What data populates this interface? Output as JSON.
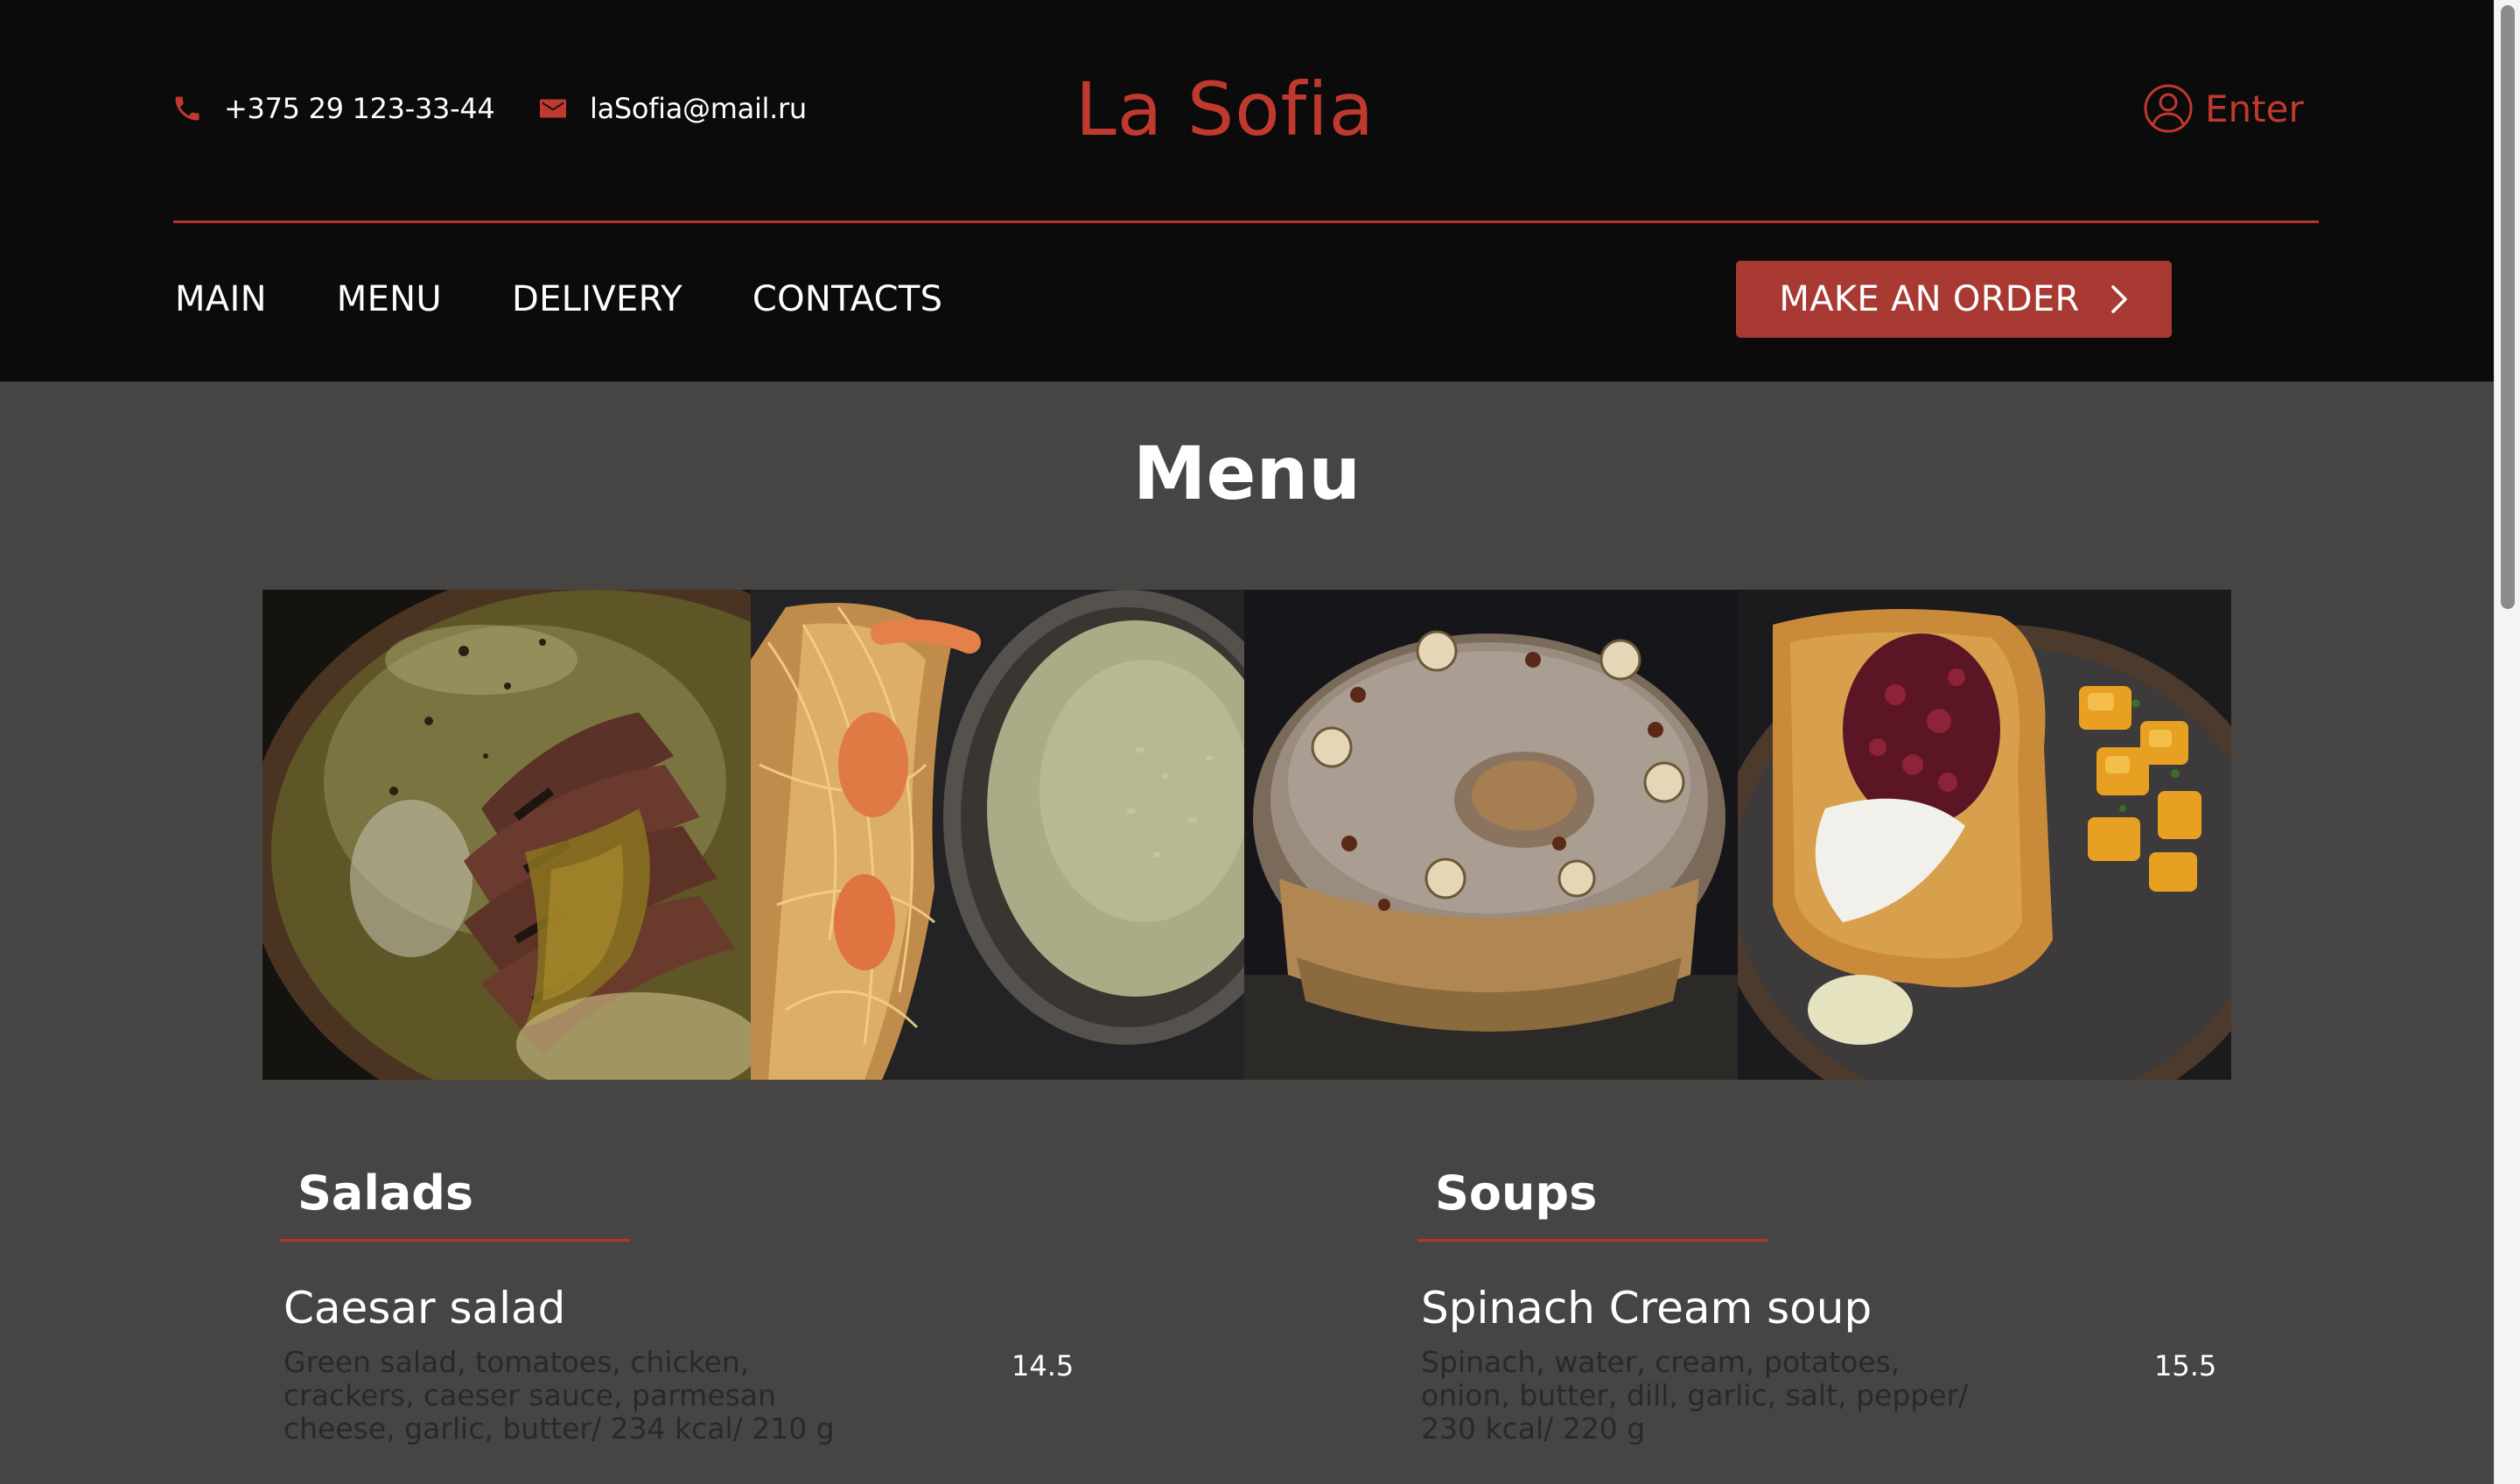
{
  "header": {
    "phone": "+375 29 123-33-44",
    "email": "laSofia@mail.ru",
    "logo": "La Sofia",
    "enter_label": "Enter",
    "nav": [
      "MAIN",
      "MENU",
      "DELIVERY",
      "CONTACTS"
    ],
    "order_button": "MAKE AN ORDER",
    "icons": {
      "phone": "phone-icon",
      "email": "mail-icon",
      "enter": "user-circle-icon",
      "order": "chevron-right-icon"
    }
  },
  "page": {
    "title": "Menu"
  },
  "gallery": {
    "photos": [
      "sliced-duck-dish-photo",
      "shrimp-and-cream-soup-photo",
      "hazelnut-paris-brest-photo",
      "brioche-toast-with-jam-photo"
    ]
  },
  "menu": {
    "sections": [
      {
        "category": "Salads",
        "dishes": [
          {
            "name": "Caesar salad",
            "description": "Green salad, tomatoes, chicken, crackers, caeser sauce, parmesan cheese, garlic, butter/ 234 kcal/ 210 g",
            "price": "14.5"
          }
        ]
      },
      {
        "category": "Soups",
        "dishes": [
          {
            "name": "Spinach Cream soup",
            "description": "Spinach, water, cream, potatoes, onion, butter, dill, garlic, salt, pepper/ 230 kcal/ 220 g",
            "price": "15.5"
          }
        ]
      }
    ]
  },
  "colors": {
    "accent": "#c0392f",
    "button": "#a93a33",
    "header_bg": "#0b0b0c",
    "page_bg": "#474444"
  }
}
